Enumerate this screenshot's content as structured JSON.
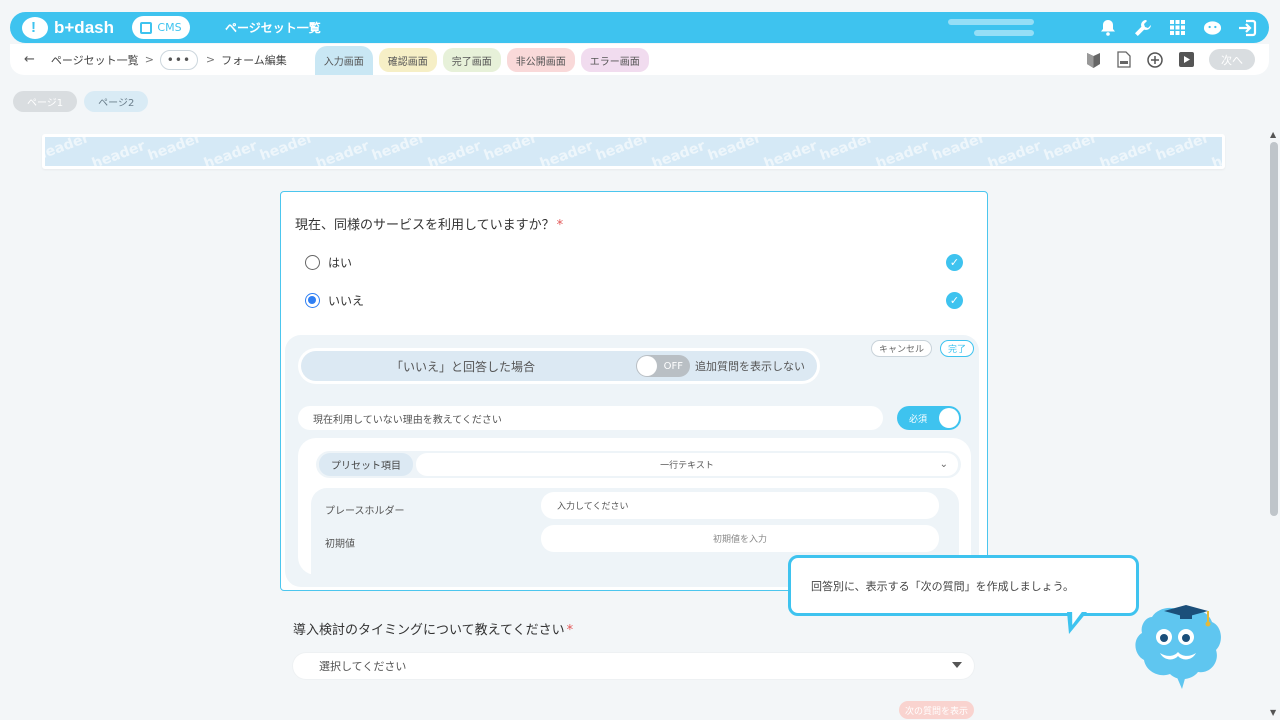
{
  "topbar": {
    "logo_text": "b+dash",
    "cms_label": "CMS",
    "title": "ページセット一覧",
    "icons": [
      "bell-icon",
      "wrench-icon",
      "grid-icon",
      "mascot-icon",
      "logout-icon"
    ]
  },
  "subbar": {
    "back_icon": "back-arrow-icon",
    "breadcrumb_1": "ページセット一覧",
    "sep": ">",
    "more": "•••",
    "breadcrumb_2": "フォーム編集",
    "tabs": [
      {
        "label": "入力画面"
      },
      {
        "label": "確認画面"
      },
      {
        "label": "完了画面"
      },
      {
        "label": "非公開画面"
      },
      {
        "label": "エラー画面"
      }
    ],
    "tools": [
      "beginner-icon",
      "html-file-icon",
      "add-circle-icon",
      "play-icon"
    ],
    "next_label": "次へ"
  },
  "pages": {
    "p1": "ページ1",
    "p2": "ページ2"
  },
  "header_banner": {
    "text": "header"
  },
  "question1": {
    "text": "現在、同様のサービスを利用していますか？",
    "required_mark": "*",
    "options": [
      {
        "label": "はい",
        "selected": false
      },
      {
        "label": "いいえ",
        "selected": true
      }
    ]
  },
  "branch_panel": {
    "cancel": "キャンセル",
    "done": "完了",
    "condition": "「いいえ」と回答した場合",
    "toggle_state": "OFF",
    "toggle_note": "追加質問を表示しない",
    "sub_question": "現在利用していない理由を教えてください",
    "required_toggle": "必須",
    "preset_label": "プリセット項目",
    "preset_value": "一行テキスト",
    "placeholder_label": "プレースホルダー",
    "placeholder_value": "入力してください",
    "default_label": "初期値",
    "default_value": "初期値を入力"
  },
  "question2": {
    "text": "導入検討のタイミングについて教えてください",
    "required_mark": "*",
    "select_placeholder": "選択してください",
    "next_question_btn": "次の質問を表示"
  },
  "tooltip": {
    "text": "回答別に、表示する「次の質問」を作成しましょう。"
  },
  "colors": {
    "accent": "#3ec3ef",
    "required": "#e25656",
    "radio_selected": "#2f7ff3"
  }
}
